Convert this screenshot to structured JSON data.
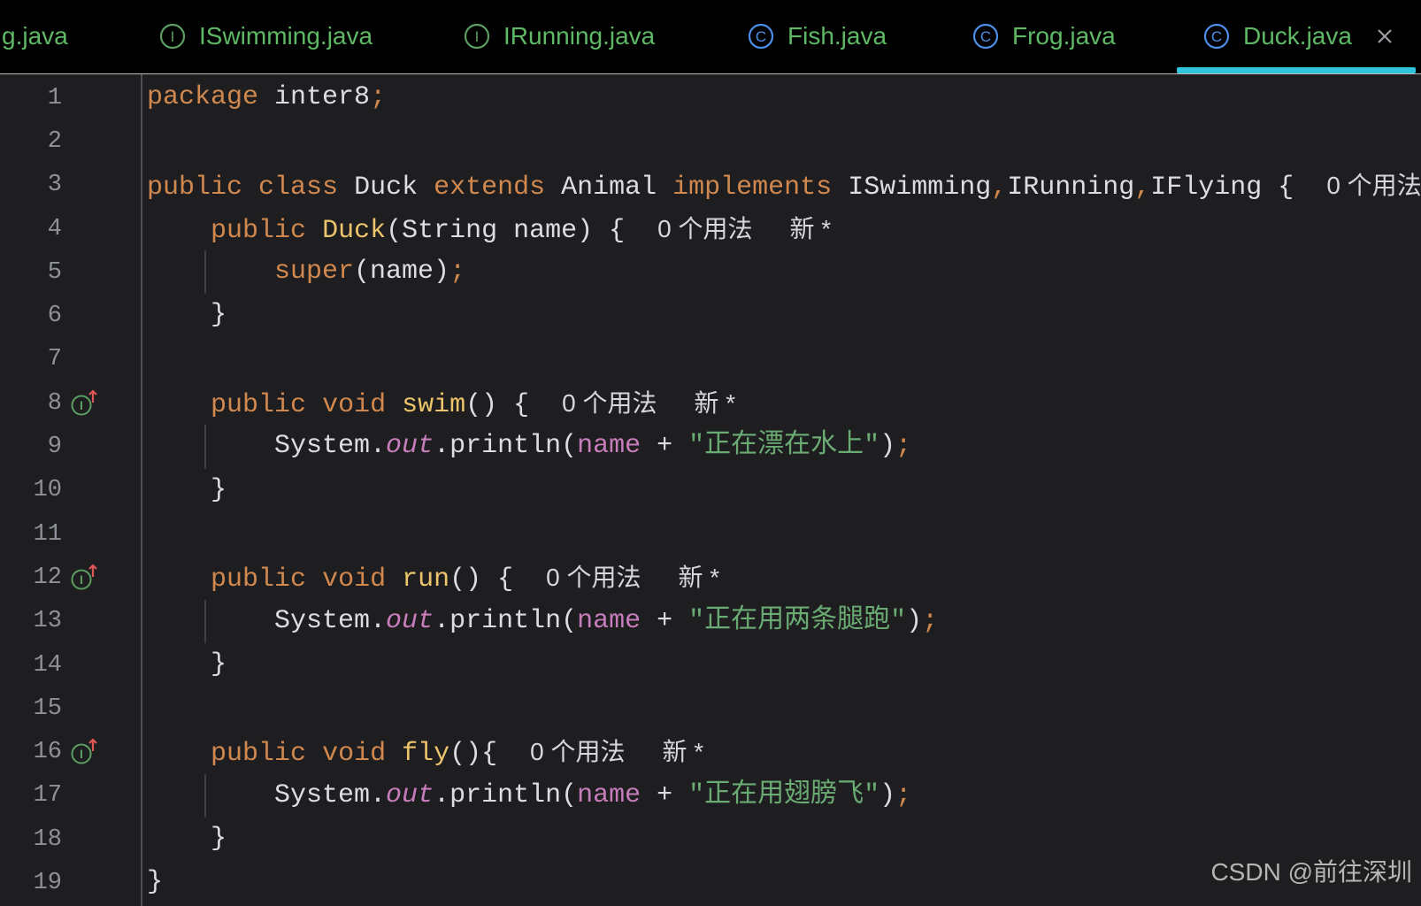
{
  "editor_tabs": [
    {
      "label": "g.java",
      "icon": null,
      "active": false
    },
    {
      "label": "ISwimming.java",
      "icon": "interface-icon",
      "icon_letter": "I",
      "active": false
    },
    {
      "label": "IRunning.java",
      "icon": "interface-icon",
      "icon_letter": "I",
      "active": false
    },
    {
      "label": "Fish.java",
      "icon": "class-icon",
      "icon_letter": "C",
      "active": false
    },
    {
      "label": "Frog.java",
      "icon": "class-icon",
      "icon_letter": "C",
      "active": false
    },
    {
      "label": "Duck.java",
      "icon": "class-icon",
      "icon_letter": "C",
      "active": true,
      "close_icon": "close-icon"
    }
  ],
  "code_lines": [
    {
      "number": "1",
      "tokens": [
        {
          "type": "keyword",
          "text": "package"
        },
        {
          "type": "plain",
          "text": " inter8"
        },
        {
          "type": "punct",
          "text": ";"
        }
      ]
    },
    {
      "number": "2",
      "tokens": []
    },
    {
      "number": "3",
      "tokens": [
        {
          "type": "keyword",
          "text": "public"
        },
        {
          "type": "plain",
          "text": " "
        },
        {
          "type": "keyword",
          "text": "class"
        },
        {
          "type": "plain",
          "text": " Duck "
        },
        {
          "type": "keyword",
          "text": "extends"
        },
        {
          "type": "plain",
          "text": " Animal "
        },
        {
          "type": "keyword",
          "text": "implements"
        },
        {
          "type": "plain",
          "text": " ISwimming"
        },
        {
          "type": "punct",
          "text": ","
        },
        {
          "type": "plain",
          "text": "IRunning"
        },
        {
          "type": "punct",
          "text": ","
        },
        {
          "type": "plain",
          "text": "IFlying {"
        }
      ],
      "hints": [
        {
          "kind": "usages",
          "text": "0 个用法"
        }
      ]
    },
    {
      "number": "4",
      "tokens": [
        {
          "type": "plain",
          "text": "    "
        },
        {
          "type": "keyword",
          "text": "public"
        },
        {
          "type": "plain",
          "text": " "
        },
        {
          "type": "method",
          "text": "Duck"
        },
        {
          "type": "plain",
          "text": "(String name) {"
        }
      ],
      "hints": [
        {
          "kind": "usages",
          "text": "0 个用法"
        },
        {
          "kind": "author",
          "text": "新 *"
        }
      ]
    },
    {
      "number": "5",
      "tokens": [
        {
          "type": "plain",
          "text": "        "
        },
        {
          "type": "keyword",
          "text": "super"
        },
        {
          "type": "plain",
          "text": "(name)"
        },
        {
          "type": "punct",
          "text": ";"
        }
      ]
    },
    {
      "number": "6",
      "tokens": [
        {
          "type": "plain",
          "text": "    }"
        }
      ]
    },
    {
      "number": "7",
      "tokens": []
    },
    {
      "number": "8",
      "gutter_icon": {
        "name": "implementing-method-icon",
        "letter": "I"
      },
      "tokens": [
        {
          "type": "plain",
          "text": "    "
        },
        {
          "type": "keyword",
          "text": "public"
        },
        {
          "type": "plain",
          "text": " "
        },
        {
          "type": "keyword",
          "text": "void"
        },
        {
          "type": "plain",
          "text": " "
        },
        {
          "type": "method",
          "text": "swim"
        },
        {
          "type": "plain",
          "text": "() {"
        }
      ],
      "hints": [
        {
          "kind": "usages",
          "text": "0 个用法"
        },
        {
          "kind": "author",
          "text": "新 *"
        }
      ]
    },
    {
      "number": "9",
      "tokens": [
        {
          "type": "plain",
          "text": "        System."
        },
        {
          "type": "static-field",
          "text": "out"
        },
        {
          "type": "plain",
          "text": ".println("
        },
        {
          "type": "field",
          "text": "name"
        },
        {
          "type": "plain",
          "text": " + "
        },
        {
          "type": "string",
          "text": "\"正在漂在水上\""
        },
        {
          "type": "plain",
          "text": ")"
        },
        {
          "type": "punct",
          "text": ";"
        }
      ]
    },
    {
      "number": "10",
      "tokens": [
        {
          "type": "plain",
          "text": "    }"
        }
      ]
    },
    {
      "number": "11",
      "tokens": []
    },
    {
      "number": "12",
      "gutter_icon": {
        "name": "implementing-method-icon",
        "letter": "I"
      },
      "tokens": [
        {
          "type": "plain",
          "text": "    "
        },
        {
          "type": "keyword",
          "text": "public"
        },
        {
          "type": "plain",
          "text": " "
        },
        {
          "type": "keyword",
          "text": "void"
        },
        {
          "type": "plain",
          "text": " "
        },
        {
          "type": "method",
          "text": "run"
        },
        {
          "type": "plain",
          "text": "() {"
        }
      ],
      "hints": [
        {
          "kind": "usages",
          "text": "0 个用法"
        },
        {
          "kind": "author",
          "text": "新 *"
        }
      ]
    },
    {
      "number": "13",
      "tokens": [
        {
          "type": "plain",
          "text": "        System."
        },
        {
          "type": "static-field",
          "text": "out"
        },
        {
          "type": "plain",
          "text": ".println("
        },
        {
          "type": "field",
          "text": "name"
        },
        {
          "type": "plain",
          "text": " + "
        },
        {
          "type": "string",
          "text": "\"正在用两条腿跑\""
        },
        {
          "type": "plain",
          "text": ")"
        },
        {
          "type": "punct",
          "text": ";"
        }
      ]
    },
    {
      "number": "14",
      "tokens": [
        {
          "type": "plain",
          "text": "    }"
        }
      ]
    },
    {
      "number": "15",
      "tokens": []
    },
    {
      "number": "16",
      "gutter_icon": {
        "name": "implementing-method-icon",
        "letter": "I"
      },
      "tokens": [
        {
          "type": "plain",
          "text": "    "
        },
        {
          "type": "keyword",
          "text": "public"
        },
        {
          "type": "plain",
          "text": " "
        },
        {
          "type": "keyword",
          "text": "void"
        },
        {
          "type": "plain",
          "text": " "
        },
        {
          "type": "method",
          "text": "fly"
        },
        {
          "type": "plain",
          "text": "(){"
        }
      ],
      "hints": [
        {
          "kind": "usages",
          "text": "0 个用法"
        },
        {
          "kind": "author",
          "text": "新 *"
        }
      ]
    },
    {
      "number": "17",
      "tokens": [
        {
          "type": "plain",
          "text": "        System."
        },
        {
          "type": "static-field",
          "text": "out"
        },
        {
          "type": "plain",
          "text": ".println("
        },
        {
          "type": "field",
          "text": "name"
        },
        {
          "type": "plain",
          "text": " + "
        },
        {
          "type": "string",
          "text": "\"正在用翅膀飞\""
        },
        {
          "type": "plain",
          "text": ")"
        },
        {
          "type": "punct",
          "text": ";"
        }
      ]
    },
    {
      "number": "18",
      "tokens": [
        {
          "type": "plain",
          "text": "    }"
        }
      ]
    },
    {
      "number": "19",
      "tokens": [
        {
          "type": "plain",
          "text": "}"
        }
      ]
    }
  ],
  "watermark": "CSDN @前往深圳",
  "theme": {
    "editor_bg": "#1e1e20",
    "tabbar_bg": "#000000",
    "tab_text": "#5fb865",
    "active_tab_underline": "#2fc4dc",
    "interface_icon": "#5c9e62",
    "class_icon": "#4d8de8",
    "text": "#dcdde1",
    "keyword": "#d0884f",
    "method_decl": "#ebc46b",
    "field": "#c77dbb",
    "string": "#6aab73",
    "line_number": "#8e9197",
    "inlay_hint": "#d5d7dc",
    "gutter_arrow": "#e05555"
  }
}
